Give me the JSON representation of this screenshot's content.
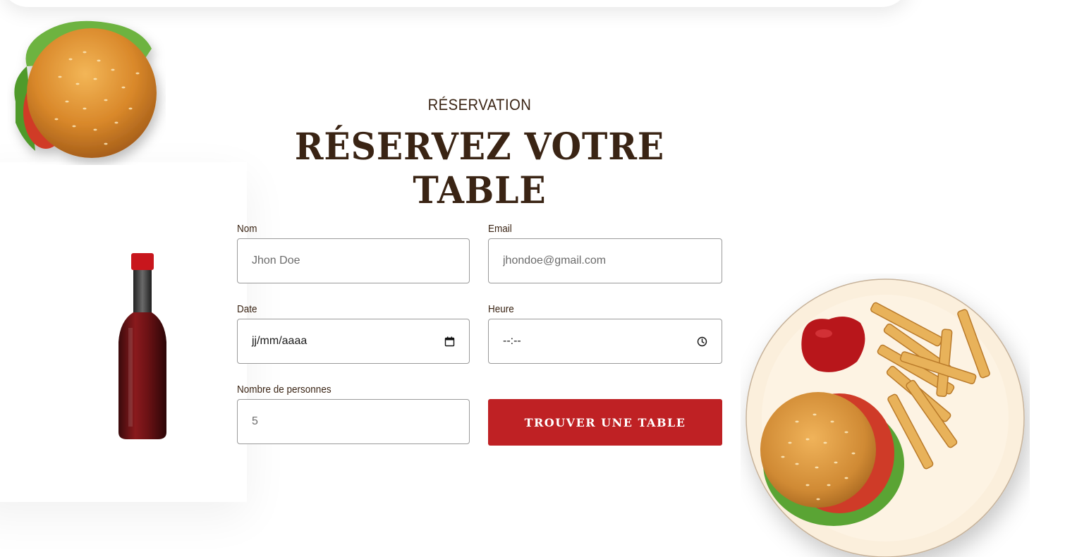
{
  "section": {
    "eyebrow": "RÉSERVATION",
    "title": "RÉSERVEZ VOTRE TABLE"
  },
  "form": {
    "name": {
      "label": "Nom",
      "placeholder": "Jhon Doe"
    },
    "email": {
      "label": "Email",
      "placeholder": "jhondoe@gmail.com"
    },
    "date": {
      "label": "Date",
      "value": "jj/mm/aaaa",
      "icon": "calendar-icon"
    },
    "time": {
      "label": "Heure",
      "value": "--:--",
      "icon": "clock-icon"
    },
    "guests": {
      "label": "Nombre de personnes",
      "placeholder": "5"
    },
    "submit_label": "TROUVER UNE TABLE"
  },
  "decor": {
    "images": [
      "burger-image",
      "hot-sauce-bottle-image",
      "burger-and-fries-plate-image"
    ]
  },
  "colors": {
    "heading": "#3a2414",
    "button": "#bf2124",
    "border": "#9a9a9a"
  }
}
